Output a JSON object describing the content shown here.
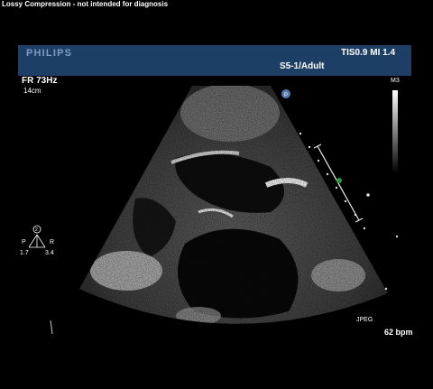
{
  "top_note": "Lossy Compression - not intended for diagnosis",
  "header": {
    "brand": "PHILIPS",
    "tis_mi": "TIS0.9   MI 1.4",
    "probe": "S5-1/Adult"
  },
  "left_info": {
    "frame_rate": "FR 73Hz",
    "depth": "14cm"
  },
  "orientation": {
    "top_label": "2",
    "left_label": "P",
    "right_label": "R",
    "left_value": "1.7",
    "right_value": "3.4"
  },
  "scale_label": "M3",
  "format_label": "JPEG",
  "heart_rate": "62 bpm",
  "colors": {
    "header_bg": "#1d3f66",
    "brand": "#7f9cc4",
    "marker": "#5577aa",
    "focus_marker": "#2a9a4a"
  }
}
